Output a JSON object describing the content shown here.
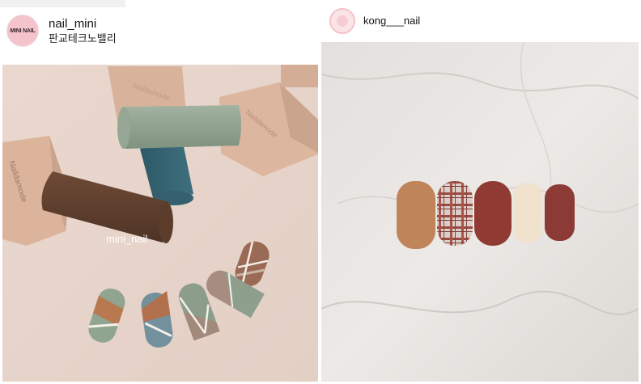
{
  "posts": [
    {
      "username": "nail_mini",
      "location": "판교테크노밸리",
      "avatar_text": "MINI NAIL",
      "bottle_text": "Naildamode",
      "photo_watermark": "mini_nail",
      "photo_subject": "nail polish bottles with green, terracotta, beige and grey geometric tip nail designs"
    },
    {
      "username": "kong___nail",
      "photo_subject": "five matte nail tips (mustard, plaid, burgundy, cream, burgundy) on marble"
    }
  ],
  "colors": {
    "avatar_pink": "#f4c3cc",
    "bottle_beige": "#d9b39b",
    "sage_green": "#8fa18f",
    "burgundy": "#8e3a34"
  }
}
